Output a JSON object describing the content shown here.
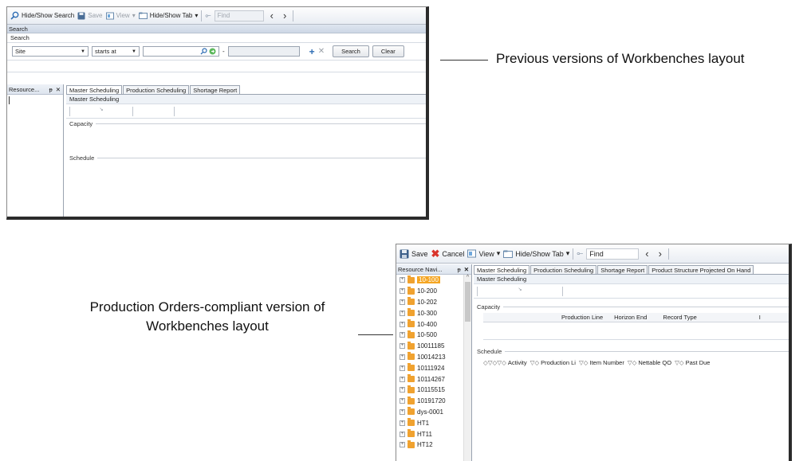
{
  "annotations": {
    "previous_label": "Previous versions of Workbenches layout",
    "compliant_label_line1": "Production Orders-compliant version of",
    "compliant_label_line2": "Workbenches layout"
  },
  "old_ui": {
    "toolbar": {
      "hide_show_search": "Hide/Show Search",
      "save": "Save",
      "view": "View",
      "hide_show_tab": "Hide/Show Tab",
      "find_placeholder": "Find"
    },
    "search_bar_title": "Search",
    "search_group_label": "Search",
    "search_row": {
      "field": "Site",
      "operator": "starts at",
      "value": "",
      "dash": "-",
      "search_button": "Search",
      "clear_button": "Clear"
    },
    "resource_panel_title": "Resource...",
    "tabs": [
      "Master Scheduling",
      "Production Scheduling",
      "Shortage Report"
    ],
    "section_title": "Master Scheduling",
    "capacity_label": "Capacity",
    "schedule_label": "Schedule"
  },
  "new_ui": {
    "toolbar": {
      "save": "Save",
      "cancel": "Cancel",
      "view": "View",
      "hide_show_tab": "Hide/Show Tab",
      "find_value": "Find"
    },
    "resource_panel_title": "Resource Navi...",
    "tree_items": [
      "10-100",
      "10-200",
      "10-202",
      "10-300",
      "10-400",
      "10-500",
      "10011185",
      "10014213",
      "10111924",
      "10114267",
      "10115515",
      "10191720",
      "dys-0001",
      "HT1",
      "HT11",
      "HT12"
    ],
    "tabs": [
      "Master Scheduling",
      "Production Scheduling",
      "Shortage Report",
      "Product Structure Projected On Hand"
    ],
    "section_title": "Master Scheduling",
    "capacity_label": "Capacity",
    "capacity_columns": [
      "Production Line",
      "Horizon End",
      "Record Type",
      "I"
    ],
    "schedule_label": "Schedule",
    "schedule_columns": [
      "Activity",
      "Production Li",
      "Item Number",
      "Nettable QO",
      "Past Due"
    ]
  }
}
